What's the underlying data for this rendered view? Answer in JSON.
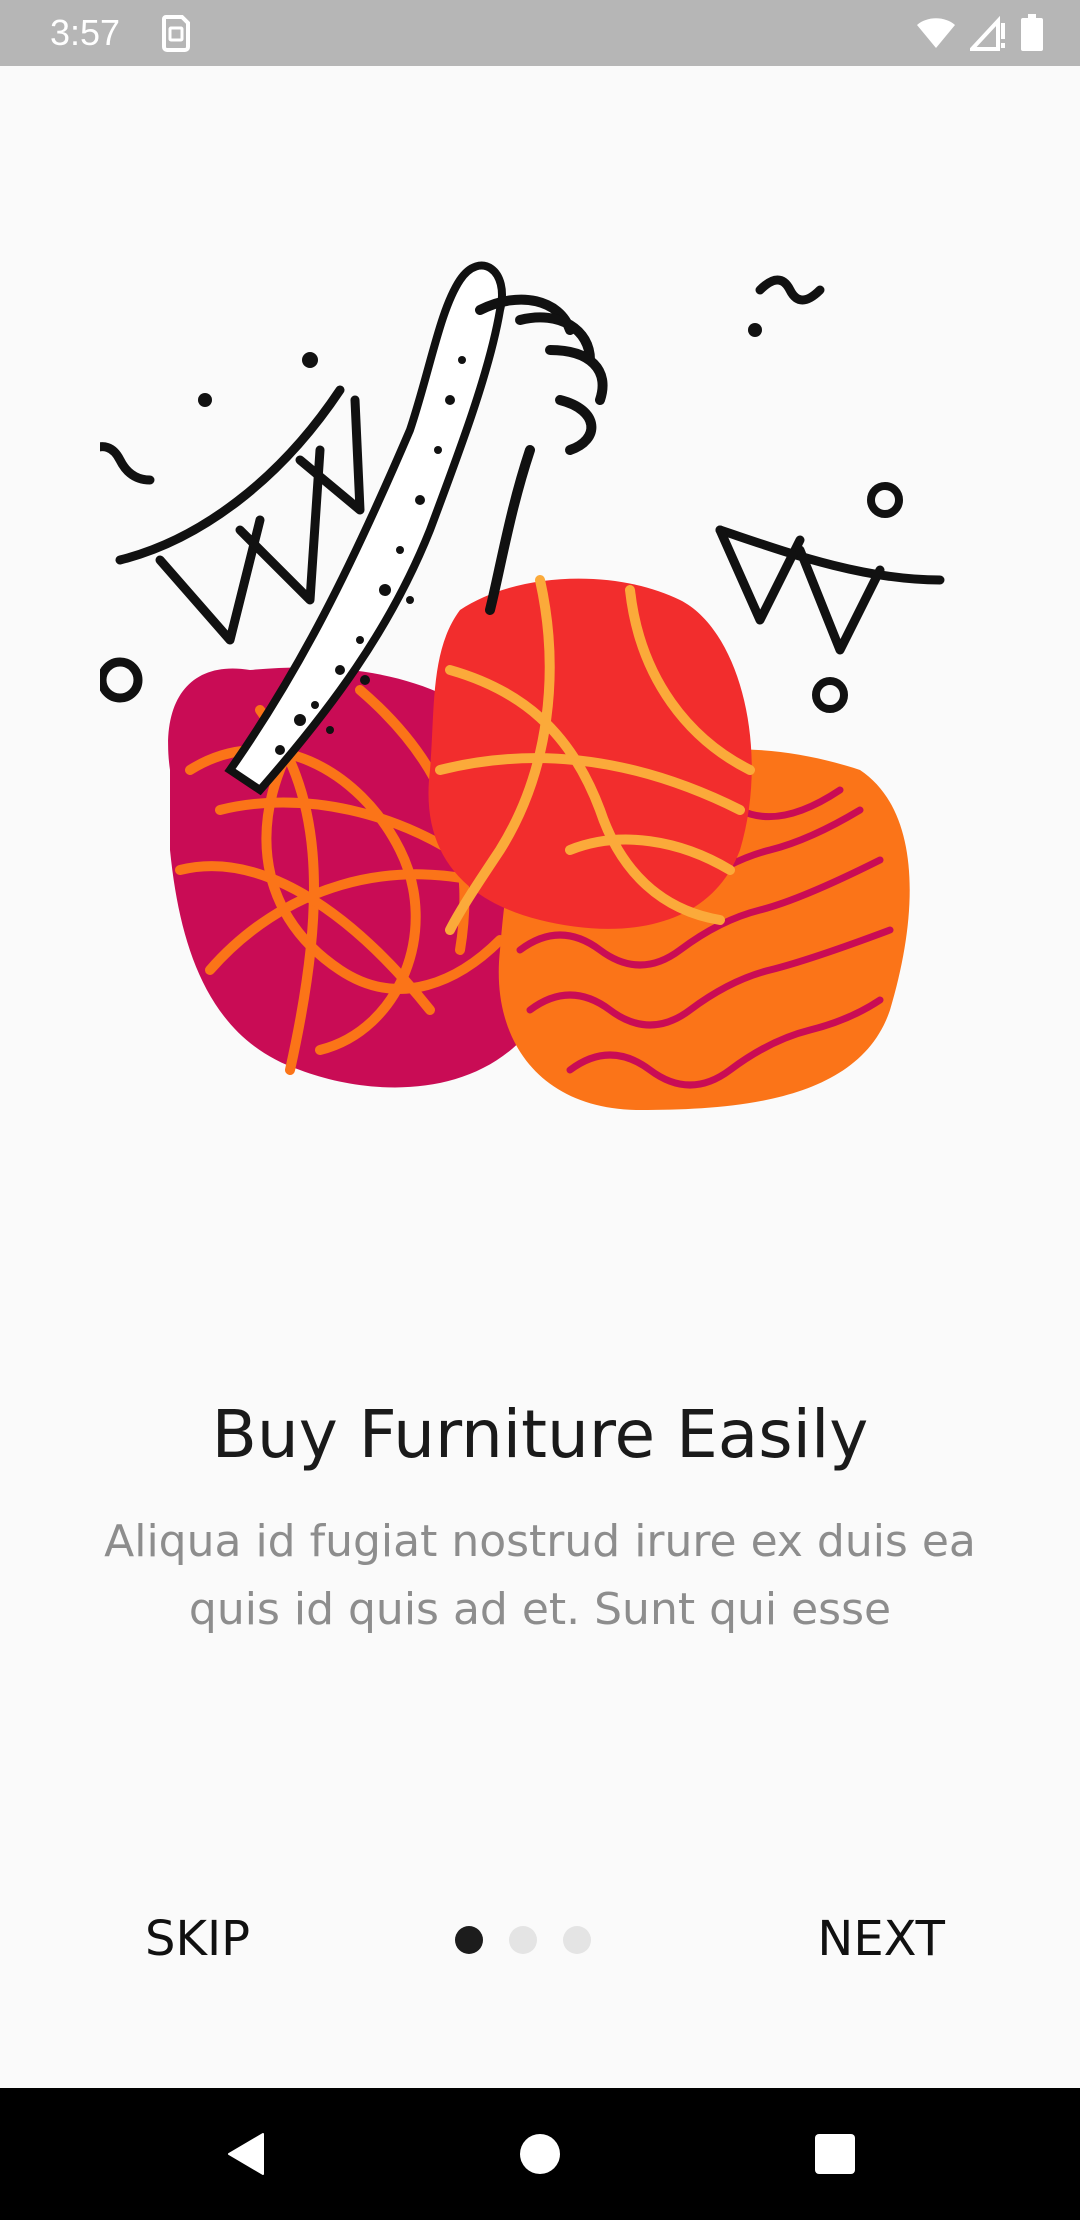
{
  "status_bar": {
    "time": "3:57",
    "app_icon": "sim-card-icon",
    "icons": [
      "wifi-icon",
      "signal-icon",
      "battery-icon"
    ]
  },
  "onboarding": {
    "illustration": "furniture-illustration",
    "title": "Buy Furniture Easily",
    "subtitle": "Aliqua id fugiat nostrud irure ex duis ea quis id quis ad et. Sunt qui esse",
    "skip_label": "SKIP",
    "next_label": "NEXT",
    "page_count": 3,
    "current_page": 1
  },
  "nav_bar": {
    "icons": [
      "back-icon",
      "home-icon",
      "recents-icon"
    ]
  },
  "colors": {
    "magenta": "#c90c55",
    "red": "#f22d2d",
    "orange": "#fb7418",
    "yellow": "#fbaa3a",
    "ink": "#111111"
  }
}
